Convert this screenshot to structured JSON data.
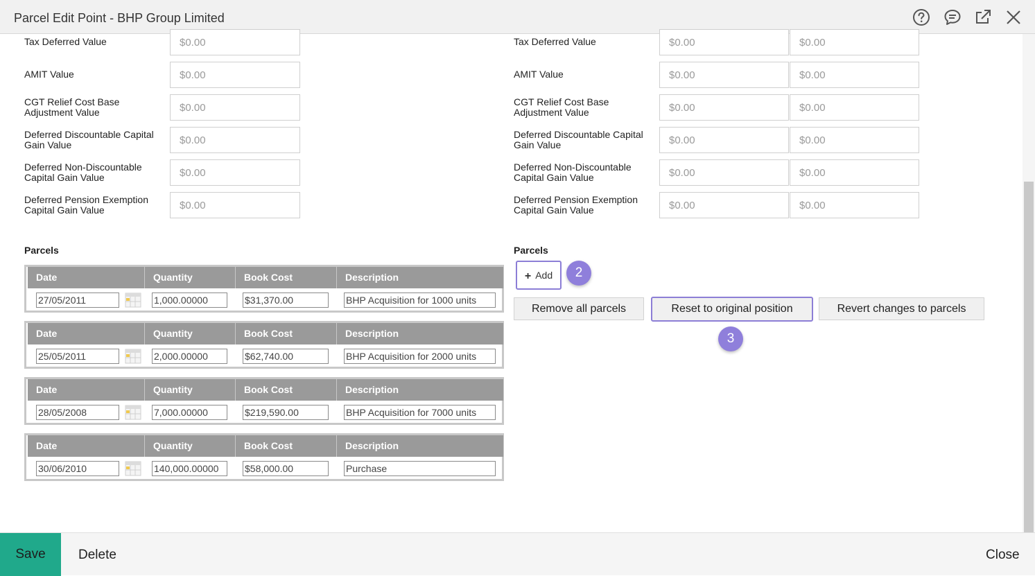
{
  "window": {
    "title": "Parcel Edit Point - BHP Group Limited",
    "icons": [
      "help-icon",
      "chat-icon",
      "popout-icon",
      "close-icon"
    ]
  },
  "left_fields": [
    {
      "label": "Tax Deferred Value",
      "value": "$0.00"
    },
    {
      "label": "AMIT Value",
      "value": "$0.00"
    },
    {
      "label": "CGT Relief Cost Base Adjustment Value",
      "value": "$0.00"
    },
    {
      "label": "Deferred Discountable Capital Gain Value",
      "value": "$0.00"
    },
    {
      "label": "Deferred Non-Discountable Capital Gain Value",
      "value": "$0.00"
    },
    {
      "label": "Deferred Pension Exemption Capital Gain Value",
      "value": "$0.00"
    }
  ],
  "right_fields": [
    {
      "label": "Tax Deferred Value",
      "value1": "$0.00",
      "value2": "$0.00"
    },
    {
      "label": "AMIT Value",
      "value1": "$0.00",
      "value2": "$0.00"
    },
    {
      "label": "CGT Relief Cost Base Adjustment Value",
      "value1": "$0.00",
      "value2": "$0.00"
    },
    {
      "label": "Deferred Discountable Capital Gain Value",
      "value1": "$0.00",
      "value2": "$0.00"
    },
    {
      "label": "Deferred Non-Discountable Capital Gain Value",
      "value1": "$0.00",
      "value2": "$0.00"
    },
    {
      "label": "Deferred Pension Exemption Capital Gain Value",
      "value1": "$0.00",
      "value2": "$0.00"
    }
  ],
  "parcels_left": {
    "label": "Parcels",
    "columns": [
      "Date",
      "Quantity",
      "Book Cost",
      "Description"
    ],
    "rows": [
      {
        "date": "27/05/2011",
        "quantity": "1,000.00000",
        "book_cost": "$31,370.00",
        "description": "BHP Acquisition for 1000 units"
      },
      {
        "date": "25/05/2011",
        "quantity": "2,000.00000",
        "book_cost": "$62,740.00",
        "description": "BHP Acquisition for 2000 units"
      },
      {
        "date": "28/05/2008",
        "quantity": "7,000.00000",
        "book_cost": "$219,590.00",
        "description": "BHP Acquisition for 7000 units"
      },
      {
        "date": "30/06/2010",
        "quantity": "140,000.00000",
        "book_cost": "$58,000.00",
        "description": "Purchase"
      }
    ]
  },
  "parcels_right": {
    "label": "Parcels",
    "add_label": "Add",
    "buttons": {
      "remove_all": "Remove all parcels",
      "reset": "Reset to original position",
      "revert": "Revert changes to parcels"
    },
    "step_badges": [
      "2",
      "3"
    ],
    "highlight_color": "#8f7fdb"
  },
  "footer": {
    "save": "Save",
    "delete": "Delete",
    "close": "Close",
    "save_color": "#20a98b"
  }
}
